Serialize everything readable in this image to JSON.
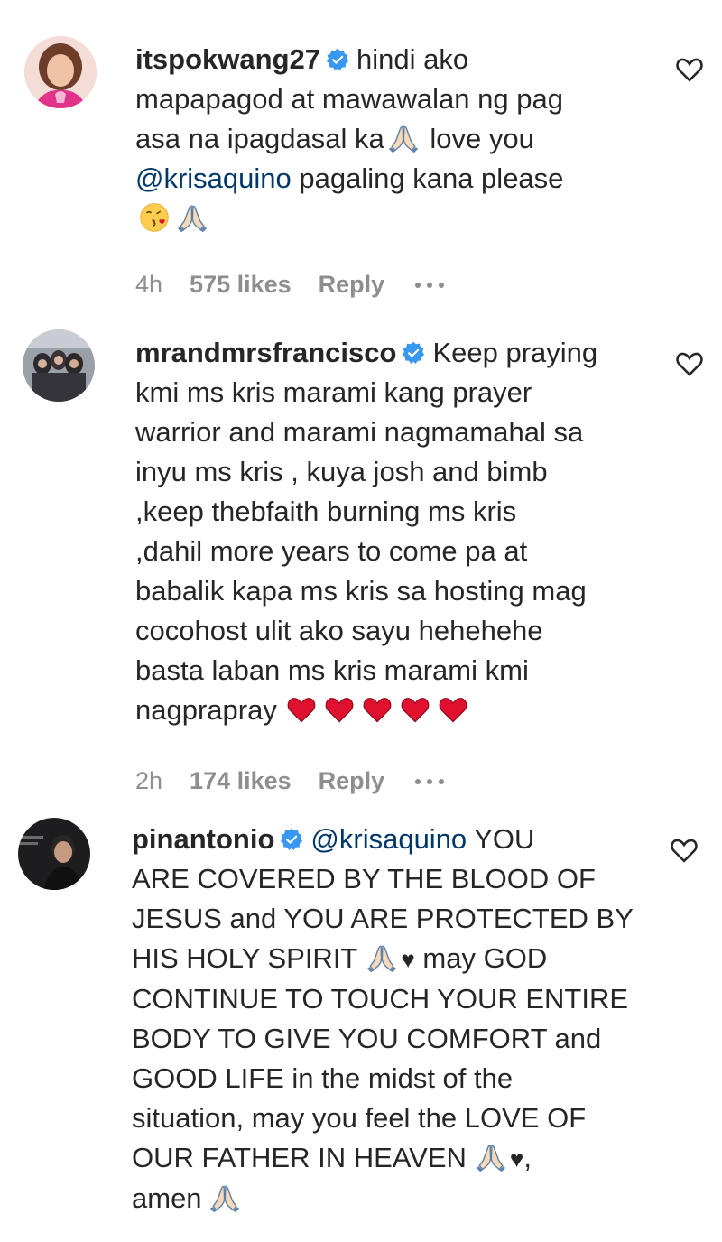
{
  "comments": [
    {
      "username": "itspokwang27",
      "lines": [
        {
          "text": "hindi ako"
        },
        {
          "text": "mapapagod at mawawalan ng pag"
        },
        {
          "text": "asa na ipagdasal ka",
          "emoji_after": "folded-hands",
          "text2": " love you"
        },
        {
          "mention": "@krisaquino",
          "text": " pagaling kana please"
        },
        {
          "emojis": [
            "kissing-face",
            "folded-hands"
          ]
        }
      ],
      "time": "4h",
      "likes": "575 likes",
      "reply": "Reply"
    },
    {
      "username": "mrandmrsfrancisco",
      "lines": [
        "Keep praying",
        "kmi ms kris marami kang prayer",
        "warrior and marami nagmamahal sa",
        "inyu ms kris , kuya josh and bimb",
        ",keep thebfaith burning ms kris",
        ",dahil more years to come pa at",
        "babalik kapa ms kris sa hosting mag",
        "cocohost ulit ako sayu hehehehe",
        "basta laban ms kris marami kmi",
        "nagprapray"
      ],
      "trailing_emoji": "red-heart x5",
      "time": "2h",
      "likes": "174 likes",
      "reply": "Reply"
    },
    {
      "username": "pinantonio",
      "mention": "@krisaquino",
      "lines": [
        " YOU",
        "ARE COVERED BY THE BLOOD OF",
        "JESUS and YOU ARE PROTECTED BY",
        "HIS HOLY SPIRIT",
        " may GOD",
        "CONTINUE TO TOUCH YOUR ENTIRE",
        "BODY TO GIVE YOU COMFORT and",
        "GOOD LIFE in the midst of the",
        "situation, may you feel the LOVE OF",
        "OUR FATHER IN HEAVEN",
        ",",
        "amen"
      ],
      "black_heart": "♥"
    }
  ],
  "colors": {
    "verified": "#3897f0",
    "mention": "#00376b",
    "meta": "#8e8e8e",
    "red_heart": "#e0102e"
  },
  "icons": [
    "heart-outline-icon",
    "verified-badge-icon",
    "folded-hands-emoji",
    "kissing-face-emoji",
    "red-heart-emoji",
    "more-dots-icon"
  ]
}
